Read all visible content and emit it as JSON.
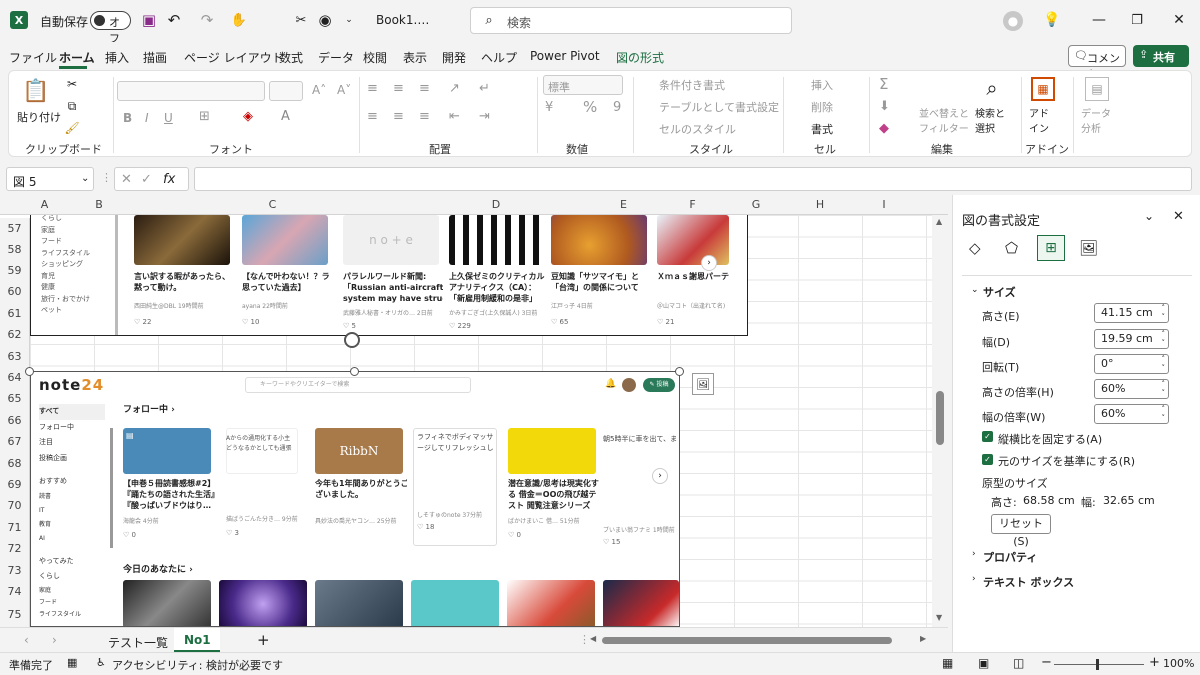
{
  "title": {
    "autosave_label": "自動保存",
    "autosave_state": "オフ",
    "file_name": "Book1.…",
    "search_placeholder": "検索"
  },
  "menu": {
    "tabs": [
      "ファイル",
      "ホーム",
      "挿入",
      "描画",
      "ページ レイアウト",
      "数式",
      "データ",
      "校閲",
      "表示",
      "開発",
      "ヘルプ",
      "Power Pivot",
      "図の形式"
    ],
    "comment_label": "コメント",
    "share_label": "共有"
  },
  "ribbon": {
    "paste_label": "貼り付け",
    "groups": [
      "クリップボード",
      "フォント",
      "配置",
      "数値",
      "スタイル",
      "セル",
      "編集",
      "アドイン"
    ],
    "number_format": "標準",
    "cond_format": "条件付き書式",
    "table_format": "テーブルとして書式設定",
    "cell_style": "セルのスタイル",
    "insert": "挿入",
    "delete": "削除",
    "format": "書式",
    "sort_filter": "並べ替えと フィルター",
    "find_select": "検索と 選択",
    "addin": "アド イン",
    "data_analysis": "データ 分析"
  },
  "formula_bar": {
    "name_box": "図 5",
    "fx": "fx"
  },
  "sheet": {
    "columns": [
      "A",
      "B",
      "C",
      "D",
      "E",
      "F",
      "G",
      "H",
      "I"
    ],
    "rows": [
      "57",
      "58",
      "59",
      "60",
      "61",
      "62",
      "63",
      "64",
      "65",
      "66",
      "67",
      "68",
      "69",
      "70",
      "71",
      "72",
      "73",
      "74",
      "75"
    ]
  },
  "upper_image": {
    "sidebar": [
      "くらし",
      "家庭",
      "フード",
      "ライフスタイル",
      "ショッピング",
      "育児",
      "健康",
      "旅行・おでかけ",
      "ペット"
    ],
    "cards": [
      {
        "title1": "言い訳する暇があったら、",
        "title2": "黙って動け。",
        "author": "西田純生@DBL 19時間前",
        "likes": "22"
      },
      {
        "title1": "【なんで叶わない！？ラ",
        "title2": "思っていた過去】",
        "author": "ayana 22時間前",
        "likes": "10"
      },
      {
        "title1": "パラレルワールド新聞:",
        "title2": "「Russian anti-aircraft",
        "title3": "system may have struc…",
        "author": "武藤雅人秘書・オリガの… 2日前",
        "likes": "5"
      },
      {
        "title1": "上久保ゼミのクリティカル",
        "title2": "アナリティクス（CA）：",
        "title3": "「新雇用制緩和の是非」",
        "author": "かみすごぎゴ(上久保誠人) 3日前",
        "likes": "229"
      },
      {
        "title1": "豆知識「サツマイモ」と",
        "title2": "「台湾」の関係について",
        "author": "江戸っ子 4日前",
        "likes": "65"
      },
      {
        "title1": "Ｘｍａｓ謝恩パーテ",
        "author": "＠山マコト（出逢れて名)",
        "likes": "21"
      }
    ]
  },
  "lower_image": {
    "logo": "note",
    "search_placeholder": "キーワードやクリエイターで検索",
    "post_label": "投稿",
    "sidebar": [
      "すべて",
      "フォロー中",
      "注目",
      "投稿企画",
      "おすすめ",
      "読書",
      "IT",
      "教育",
      "AI",
      "やってみた",
      "くらし",
      "家庭",
      "フード",
      "ライフスタイル"
    ],
    "following_heading": "フォロー中",
    "today_heading": "今日のあなたに",
    "cards": [
      {
        "title1": "【申巻５冊読書感想#2】",
        "title2": "『踊たちの語された生活』",
        "title3": "『酸っぱいブドウはり…",
        "author": "海龍会 4分前",
        "likes": "0"
      },
      {
        "title1": "Aからの通用化する小主",
        "title2": "どうなるかとしても通張",
        "author": "描ばうごんた分き… 9分前",
        "likes": "3"
      },
      {
        "title1": "今年も1年間ありがとうご",
        "title2": "ざいました。",
        "author": "具妙法の喬光ヤコン… 25分前",
        "likes": ""
      },
      {
        "title1": "ラフィネでボディマッサ",
        "title2": "ージしてリフレッシュし",
        "author": "しそすゅのnote 37分前",
        "likes": "18"
      },
      {
        "title1": "潜在意識/思考は現実化す",
        "title2": "る  借金＝OOの飛び越テ",
        "title3": "スト  閲覧注意シリーズ",
        "author": "ばかけまいこ  借… 51分前",
        "likes": "0"
      },
      {
        "title1": "朝5時半に車を出て、ま",
        "author": "ブいまい翁フナミ 1時間前",
        "likes": "15"
      }
    ],
    "brand_text": "RibbN"
  },
  "panel": {
    "title": "図の書式設定",
    "size_heading": "サイズ",
    "height_label": "高さ(E)",
    "height_value": "41.15 cm",
    "width_label": "幅(D)",
    "width_value": "19.59 cm",
    "rotation_label": "回転(T)",
    "rotation_value": "0°",
    "scale_h_label": "高さの倍率(H)",
    "scale_h_value": "60%",
    "scale_w_label": "幅の倍率(W)",
    "scale_w_value": "60%",
    "lock_aspect": "縦横比を固定する(A)",
    "relative_original": "元のサイズを基準にする(R)",
    "original_size": "原型のサイズ",
    "orig_h_label": "高さ:",
    "orig_h_value": "68.58 cm",
    "orig_w_label": "幅:",
    "orig_w_value": "32.65 cm",
    "reset": "リセット(S)",
    "properties": "プロパティ",
    "textbox": "テキスト ボックス"
  },
  "tabs": {
    "sheets": [
      "テスト一覧",
      "No1"
    ],
    "active": "No1"
  },
  "status": {
    "ready": "準備完了",
    "accessibility": "アクセシビリティ: 検討が必要です",
    "zoom": "100%"
  }
}
